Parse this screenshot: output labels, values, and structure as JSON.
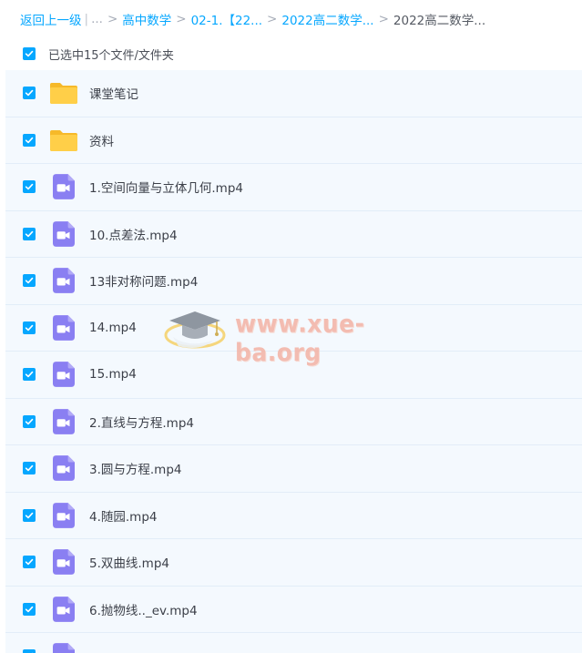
{
  "breadcrumb": {
    "back_label": "返回上一级",
    "pipe": "|",
    "ellipsis": "...",
    "sep": ">",
    "items": [
      {
        "label": "高中数学"
      },
      {
        "label": "02-1.【22..."
      },
      {
        "label": "2022高二数学..."
      }
    ],
    "current": "2022高二数学..."
  },
  "selection": {
    "label": "已选中15个文件/文件夹",
    "checked": true
  },
  "files": [
    {
      "name": "课堂笔记",
      "type": "folder",
      "icon": "folder-icon",
      "checked": true
    },
    {
      "name": "资料",
      "type": "folder",
      "icon": "folder-icon",
      "checked": true
    },
    {
      "name": "1.空间向量与立体几何.mp4",
      "type": "video",
      "icon": "video-file-icon",
      "checked": true
    },
    {
      "name": "10.点差法.mp4",
      "type": "video",
      "icon": "video-file-icon",
      "checked": true
    },
    {
      "name": "13非对称问题.mp4",
      "type": "video",
      "icon": "video-file-icon",
      "checked": true
    },
    {
      "name": "14.mp4",
      "type": "video",
      "icon": "video-file-icon",
      "checked": true
    },
    {
      "name": "15.mp4",
      "type": "video",
      "icon": "video-file-icon",
      "checked": true
    },
    {
      "name": "2.直线与方程.mp4",
      "type": "video",
      "icon": "video-file-icon",
      "checked": true
    },
    {
      "name": "3.圆与方程.mp4",
      "type": "video",
      "icon": "video-file-icon",
      "checked": true
    },
    {
      "name": "4.随园.mp4",
      "type": "video",
      "icon": "video-file-icon",
      "checked": true
    },
    {
      "name": "5.双曲线.mp4",
      "type": "video",
      "icon": "video-file-icon",
      "checked": true
    },
    {
      "name": "6.抛物线.._ev.mp4",
      "type": "video",
      "icon": "video-file-icon",
      "checked": true
    },
    {
      "name": "",
      "type": "video",
      "icon": "video-file-icon",
      "checked": true
    }
  ],
  "watermark": {
    "text": "www.xue-ba.org",
    "icon": "graduation-cap-logo"
  },
  "colors": {
    "accent": "#06a7ff",
    "row_bg": "#f4f9fe",
    "row_border": "#e2edf8",
    "folder": "#ffc93c",
    "video": "#8a7ff2",
    "watermark": "#f3b2a4"
  }
}
